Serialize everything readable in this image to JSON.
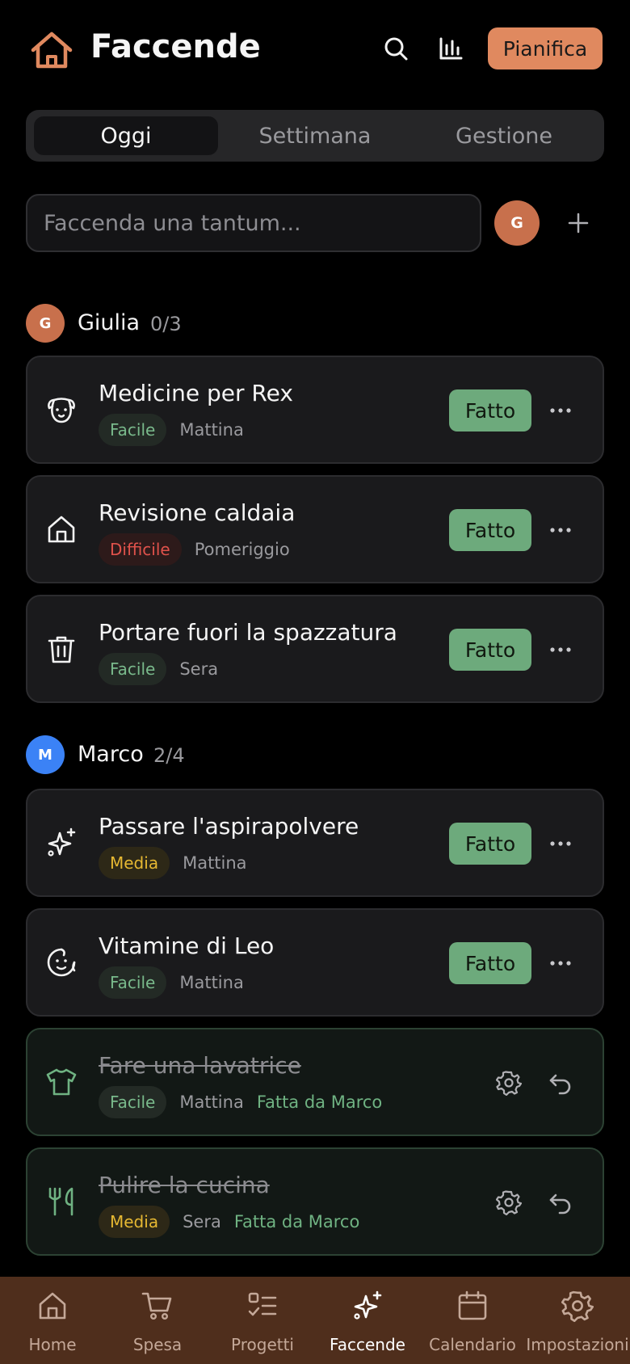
{
  "header": {
    "title": "Faccende",
    "plan_label": "Pianifica",
    "logo_icon": "house-icon",
    "search_icon": "search-icon",
    "stats_icon": "bar-chart-icon"
  },
  "tabs": [
    {
      "label": "Oggi",
      "active": true
    },
    {
      "label": "Settimana",
      "active": false
    },
    {
      "label": "Gestione",
      "active": false
    }
  ],
  "quick_add": {
    "placeholder": "Faccenda una tantum...",
    "avatar_initial": "G",
    "add_icon": "plus-icon"
  },
  "groups": [
    {
      "initial": "G",
      "name": "Giulia",
      "count": "0/3",
      "color": "#c8704c",
      "chores": [
        {
          "title": "Medicine per Rex",
          "difficulty": "Facile",
          "time": "Mattina",
          "icon": "dog-icon",
          "done": false,
          "action_label": "Fatto"
        },
        {
          "title": "Revisione caldaia",
          "difficulty": "Difficile",
          "time": "Pomeriggio",
          "icon": "house-icon",
          "done": false,
          "action_label": "Fatto"
        },
        {
          "title": "Portare fuori la spazzatura",
          "difficulty": "Facile",
          "time": "Sera",
          "icon": "trash-icon",
          "done": false,
          "action_label": "Fatto"
        }
      ]
    },
    {
      "initial": "M",
      "name": "Marco",
      "count": "2/4",
      "color": "#3b82f6",
      "chores": [
        {
          "title": "Passare l'aspirapolvere",
          "difficulty": "Media",
          "time": "Mattina",
          "icon": "sparkles-icon",
          "done": false,
          "action_label": "Fatto"
        },
        {
          "title": "Vitamine di Leo",
          "difficulty": "Facile",
          "time": "Mattina",
          "icon": "baby-icon",
          "done": false,
          "action_label": "Fatto"
        },
        {
          "title": "Fare una lavatrice",
          "difficulty": "Facile",
          "time": "Mattina",
          "icon": "shirt-icon",
          "done": true,
          "done_by": "Fatta da Marco"
        },
        {
          "title": "Pulire la cucina",
          "difficulty": "Media",
          "time": "Sera",
          "icon": "utensils-icon",
          "done": true,
          "done_by": "Fatta da Marco"
        }
      ]
    }
  ],
  "nav": [
    {
      "label": "Home",
      "icon": "home-icon",
      "active": false
    },
    {
      "label": "Spesa",
      "icon": "cart-icon",
      "active": false
    },
    {
      "label": "Progetti",
      "icon": "checklist-icon",
      "active": false
    },
    {
      "label": "Faccende",
      "icon": "sparkles-icon",
      "active": true
    },
    {
      "label": "Calendario",
      "icon": "calendar-icon",
      "active": false
    },
    {
      "label": "Impostazioni",
      "icon": "gear-icon",
      "active": false
    }
  ],
  "colors": {
    "accent": "#e0895f",
    "done_green": "#6daa7c",
    "nav_bg": "#4f2e1c"
  }
}
